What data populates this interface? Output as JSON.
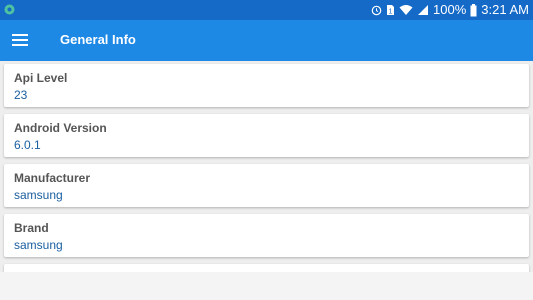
{
  "status_bar": {
    "battery": "100%",
    "time": "3:21 AM",
    "icons": [
      "app-notification-icon",
      "alarm-icon",
      "sim-icon",
      "wifi-icon",
      "signal-icon",
      "battery-icon"
    ]
  },
  "app_bar": {
    "title": "General Info",
    "menu_icon": "hamburger-menu-icon"
  },
  "colors": {
    "status_bar": "#1569c7",
    "app_bar": "#1e88e5",
    "value_text": "#1a5fa0",
    "label_text": "#555555"
  },
  "cards": [
    {
      "label": "Api Level",
      "value": "23"
    },
    {
      "label": "Android Version",
      "value": "6.0.1"
    },
    {
      "label": "Manufacturer",
      "value": "samsung"
    },
    {
      "label": "Brand",
      "value": "samsung"
    }
  ]
}
